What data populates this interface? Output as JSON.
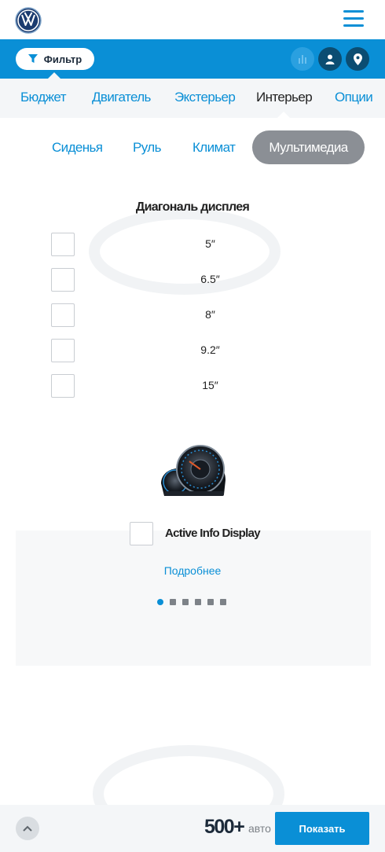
{
  "header": {
    "logo_icon": "vw-logo-icon",
    "menu_icon": "hamburger-menu-icon"
  },
  "filterbar": {
    "filter_label": "Фильтр",
    "filter_icon": "funnel-icon",
    "compare_icon": "bar-chart-icon",
    "user_icon": "user-icon",
    "location_icon": "map-pin-icon"
  },
  "categories": [
    {
      "label": "Бюджет"
    },
    {
      "label": "Двигатель"
    },
    {
      "label": "Экстерьер"
    },
    {
      "label": "Интерьер"
    },
    {
      "label": "Опции"
    }
  ],
  "subtabs": [
    {
      "label": "Сиденья"
    },
    {
      "label": "Руль"
    },
    {
      "label": "Климат"
    },
    {
      "label": "Мультимедиа"
    }
  ],
  "display_section": {
    "title": "Диагональ дисплея",
    "options": [
      {
        "label": "5″"
      },
      {
        "label": "6.5″"
      },
      {
        "label": "8″"
      },
      {
        "label": "9.2″"
      },
      {
        "label": "15″"
      }
    ]
  },
  "feature": {
    "image_icon": "instrument-cluster-icon",
    "label": "Active Info Display",
    "more_link": "Подробнее",
    "pagination_count": 6,
    "active_page": 1
  },
  "bottombar": {
    "scroll_up_icon": "chevron-up-icon",
    "count": "500+",
    "count_unit": "авто",
    "show_button": "Показать"
  },
  "colors": {
    "accent": "#0a8fd6",
    "dark_accent": "#0b4d72",
    "active_pill": "#8b8f95",
    "panel_bg": "#f4f6f8"
  }
}
